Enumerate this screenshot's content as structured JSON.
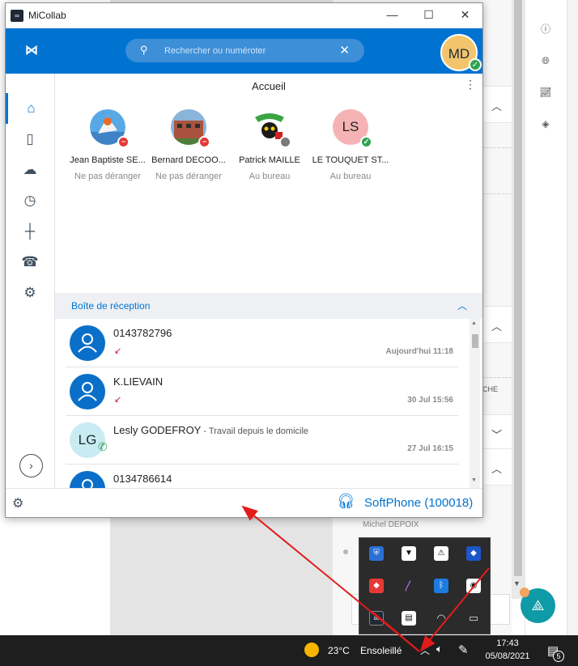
{
  "window": {
    "title": "MiCollab"
  },
  "header": {
    "search_placeholder": "Rechercher ou numéroter",
    "user_initials": "MD"
  },
  "home": {
    "title": "Accueil"
  },
  "favorites": [
    {
      "name": "Jean Baptiste SE...",
      "status": "Ne pas déranger",
      "presence": "dnd"
    },
    {
      "name": "Bernard DECOO...",
      "status": "Ne pas déranger",
      "presence": "dnd"
    },
    {
      "name": "Patrick MAILLE",
      "status": "Au bureau",
      "presence": "offline"
    },
    {
      "name": "LE TOUQUET ST...",
      "status": "Au bureau",
      "presence": "available",
      "initials": "LS"
    }
  ],
  "inbox": {
    "label": "Boîte de réception",
    "items": [
      {
        "title": "0143782796",
        "subtitle": "",
        "time": "Aujourd'hui 11:18",
        "call": "missed"
      },
      {
        "title": "K.LIEVAIN",
        "subtitle": "",
        "time": "30 Jul 15:56",
        "call": "missed"
      },
      {
        "title": "Lesly GODEFROY",
        "subtitle": " - Travail depuis le domicile",
        "time": "27 Jul 16:15",
        "call": "answered",
        "initials": "LG"
      },
      {
        "title": "0134786614",
        "subtitle": "",
        "time": "",
        "call": "missed"
      }
    ]
  },
  "footer": {
    "softphone_label": "SoftPhone (100018)"
  },
  "background": {
    "che_text": "CHE",
    "contact_name": "Michel DEPOIX"
  },
  "taskbar": {
    "temperature": "23°C",
    "weather": "Ensoleillé",
    "time": "17:43",
    "date": "05/08/2021",
    "notification_count": "5"
  },
  "colors": {
    "brand": "#0073d1",
    "dnd": "#e53935",
    "available": "#2ea44f",
    "offline": "#7a7a7a"
  }
}
